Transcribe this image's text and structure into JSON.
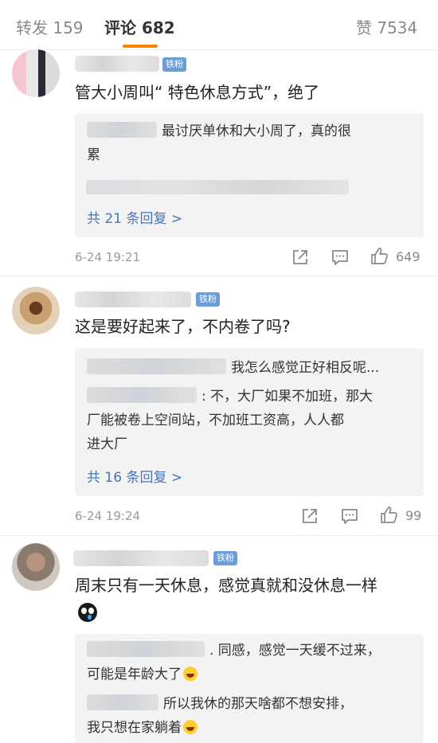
{
  "tabs": {
    "repost": "转发 159",
    "comments": "评论 682",
    "likes": "赞 7534"
  },
  "badge_label": "铁粉",
  "comments": [
    {
      "text": "管大小周叫“ 特色休息方式”，绝了",
      "replies": [
        {
          "text": "最讨厌单休和大小周了，真的很累",
          "line1": "最讨厌单休和大小周了，真的很",
          "line2": "累"
        }
      ],
      "more": "共 21 条回复 >",
      "time": "6-24 19:21",
      "like_count": "649"
    },
    {
      "text": "这是要好起来了，不内卷了吗?",
      "replies": [
        {
          "text": "我怎么感觉正好相反呢..."
        },
        {
          "text": ": 不，大厂如果不加班，那大厂能被卷上空间站，不加班工资高，人人都进大厂",
          "line1": ": 不，大厂如果不加班，那大",
          "line2": "厂能被卷上空间站，不加班工资高，人人都",
          "line3": "进大厂"
        }
      ],
      "more": "共 16 条回复 >",
      "time": "6-24 19:24",
      "like_count": "99"
    },
    {
      "text": "周末只有一天休息，感觉真就和没休息一样",
      "emoji": "crying-emoji",
      "replies": [
        {
          "text": ". 同感，感觉一天缓不过来，可能是年龄大了",
          "line1": ". 同感，感觉一天缓不过来，",
          "line2": "可能是年龄大了"
        },
        {
          "text": "所以我休的那天啥都不想安排，我只想在家躺着",
          "line1": "所以我休的那天啥都不想安排，",
          "line2": "我只想在家躺着"
        }
      ]
    }
  ],
  "icons": {
    "share": "share-icon",
    "comment": "comment-icon",
    "like": "thumbs-up-icon",
    "laugh": "laughing-emoji-icon"
  },
  "colors": {
    "accent": "#ff8200",
    "link": "#4a76b0",
    "badge": "#6b9ed9"
  }
}
